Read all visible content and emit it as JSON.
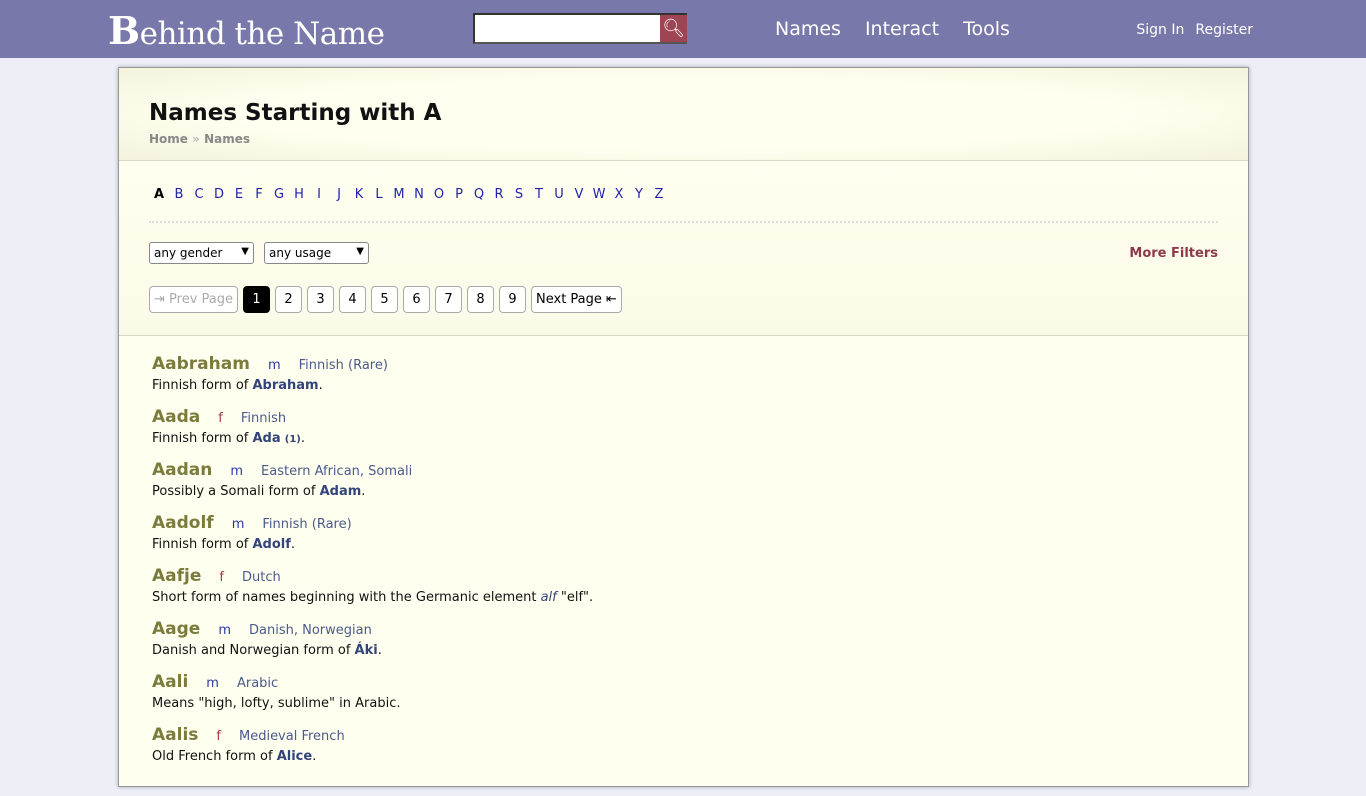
{
  "header": {
    "logo": "Behind the Name",
    "search_placeholder": "",
    "nav": [
      "Names",
      "Interact",
      "Tools"
    ],
    "sign_in": "Sign In",
    "register": "Register"
  },
  "page": {
    "title": "Names Starting with A",
    "breadcrumb": [
      "Home",
      "Names"
    ]
  },
  "letters": [
    "A",
    "B",
    "C",
    "D",
    "E",
    "F",
    "G",
    "H",
    "I",
    "J",
    "K",
    "L",
    "M",
    "N",
    "O",
    "P",
    "Q",
    "R",
    "S",
    "T",
    "U",
    "V",
    "W",
    "X",
    "Y",
    "Z"
  ],
  "filters": {
    "gender": "any gender",
    "usage": "any usage",
    "more": "More Filters"
  },
  "pagination": {
    "prev": "⇥ Prev Page",
    "pages": [
      "1",
      "2",
      "3",
      "4",
      "5",
      "6",
      "7",
      "8",
      "9"
    ],
    "current": "1",
    "next": "Next Page ⇤"
  },
  "entries": [
    {
      "name": "Aabraham",
      "gender": "m",
      "usage": "Finnish (Rare)",
      "pre": "Finnish form of ",
      "link": "Abraham",
      "post": "."
    },
    {
      "name": "Aada",
      "gender": "f",
      "usage": "Finnish",
      "pre": "Finnish form of ",
      "link": "Ada",
      "sup": "(1)",
      "post": "."
    },
    {
      "name": "Aadan",
      "gender": "m",
      "usage": "Eastern African, Somali",
      "pre": "Possibly a Somali form of ",
      "link": "Adam",
      "post": "."
    },
    {
      "name": "Aadolf",
      "gender": "m",
      "usage": "Finnish (Rare)",
      "pre": "Finnish form of ",
      "link": "Adolf",
      "post": "."
    },
    {
      "name": "Aafje",
      "gender": "f",
      "usage": "Dutch",
      "pre": "Short form of names beginning with the Germanic element ",
      "italic": "alf",
      "post": " \"elf\"."
    },
    {
      "name": "Aage",
      "gender": "m",
      "usage": "Danish, Norwegian",
      "pre": "Danish and Norwegian form of ",
      "link": "Áki",
      "post": "."
    },
    {
      "name": "Aali",
      "gender": "m",
      "usage": "Arabic",
      "pre": "Means \"high, lofty, sublime\" in Arabic.",
      "post": ""
    },
    {
      "name": "Aalis",
      "gender": "f",
      "usage": "Medieval French",
      "pre": "Old French form of ",
      "link": "Alice",
      "post": "."
    }
  ],
  "colors": {
    "header": "#7878aa",
    "search_button": "#9e4452",
    "name": "#7b7b3c",
    "link": "#33447a"
  }
}
